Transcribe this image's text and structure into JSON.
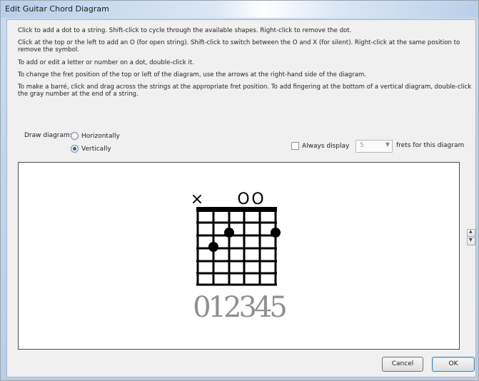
{
  "window": {
    "title": "Edit Guitar Chord Diagram"
  },
  "instructions": {
    "line1": "Click to add a dot to a string. Shift-click to cycle through the available shapes. Right-click to remove the dot.",
    "line2a": "Click at the top or the left to add an O (for open string). Shift-click to switch between the O and X (for silent). Right-click at the same position to",
    "line2b": "remove the symbol.",
    "line3": "To add or edit a letter or number on a dot, double-click it.",
    "line4": "To change the fret position of the top or left of the diagram, use the arrows at the right-hand side of the diagram.",
    "line5a": "To make a barré, click and drag across the strings at the appropriate fret position. To add fingering at the bottom of a vertical diagram, double-click",
    "line5b": "the gray number at the end of a string."
  },
  "draw_diagram": {
    "label": "Draw diagram:",
    "options": [
      {
        "label": "Horizontally",
        "selected": false
      },
      {
        "label": "Vertically",
        "selected": true
      }
    ]
  },
  "always_display": {
    "label": "Always display",
    "checked": false,
    "value": "5",
    "suffix": "frets for this diagram"
  },
  "diagram": {
    "top_symbols": [
      "×",
      "",
      "",
      "O",
      "O",
      ""
    ],
    "fingering": "012345",
    "dots": [
      {
        "string": 3,
        "fret": 2
      },
      {
        "string": 6,
        "fret": 2
      },
      {
        "string": 2,
        "fret": 3
      }
    ]
  },
  "buttons": {
    "cancel": "Cancel",
    "ok": "OK"
  },
  "colors": {
    "accent": "#3c7fb1",
    "fingering": "#8f8f8f"
  }
}
